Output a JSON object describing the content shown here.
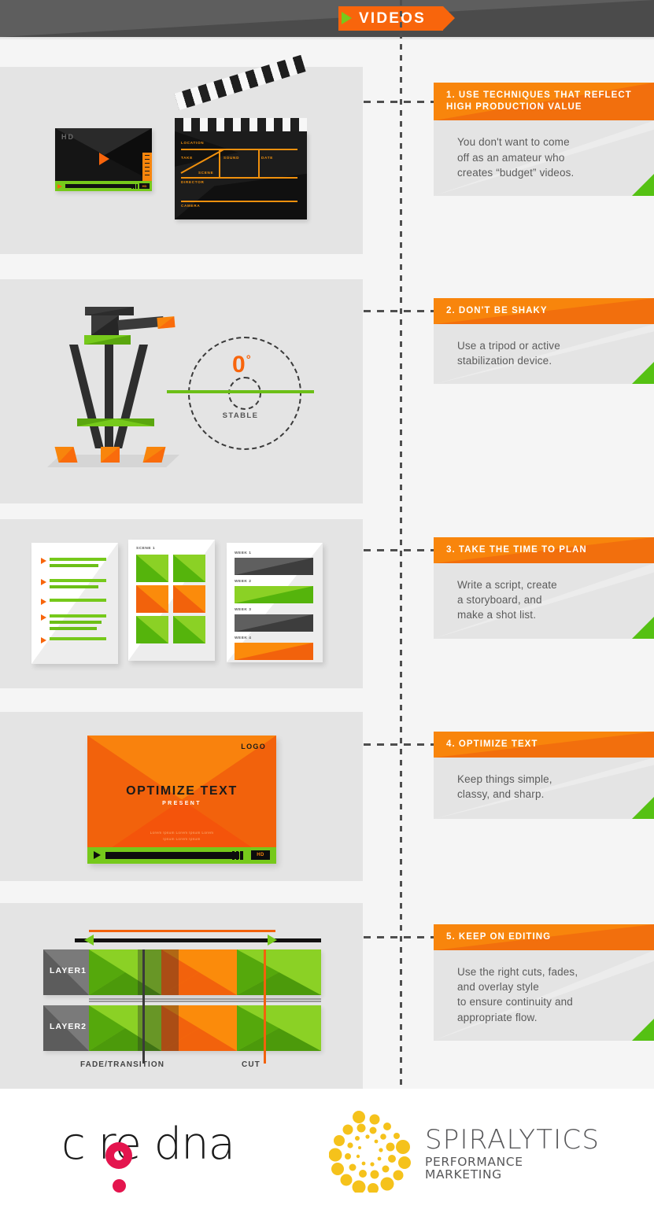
{
  "header": {
    "tag_label": "VIDEOS",
    "tag_arrow_icon": "play-triangle-icon",
    "colors": {
      "orange": "#f8650c",
      "green": "#76c91b",
      "dark_gray": "#5e5e5e"
    }
  },
  "tips": [
    {
      "title": "1. USE TECHNIQUES THAT REFLECT\nHIGH PRODUCTION VALUE",
      "body": "You don't want to come\noff as an amateur who\ncreates “budget” videos."
    },
    {
      "title": "2. DON'T BE SHAKY",
      "body": "Use a tripod or active\nstabilization device."
    },
    {
      "title": "3. TAKE THE TIME TO PLAN",
      "body": "Write a script, create\na storyboard, and\nmake a shot list."
    },
    {
      "title": "4. OPTIMIZE TEXT",
      "body": "Keep things simple,\nclassy, and sharp."
    },
    {
      "title": "5. KEEP ON EDITING",
      "body": "Use the right cuts, fades,\nand overlay style\nto ensure continuity and\nappropriate flow."
    }
  ],
  "illustration_1": {
    "player_hd_badge": "HD",
    "player_quality_badge": "HD",
    "play_icon": "play-triangle-icon",
    "clapper_fields": {
      "location": "LOCATION",
      "take": "TAKE",
      "sound": "SOUND",
      "date": "DATE",
      "scene": "SCENE",
      "director": "DIRECTOR",
      "camera": "CAMERA"
    }
  },
  "illustration_2": {
    "angle_value": "0",
    "angle_degree_symbol": "°",
    "caption": "STABLE"
  },
  "illustration_3": {
    "storyboard_label": "SCENE 1",
    "schedule_labels": [
      "WEEK 1",
      "WEEK 2",
      "WEEK 3",
      "WEEK 4"
    ],
    "schedule_bar_colors": [
      "#5f5f5f",
      "#8bd125",
      "#5f5f5f",
      "#fb8b0b"
    ],
    "storyboard_cell_colors": [
      "green",
      "green",
      "orange",
      "orange",
      "green",
      "green"
    ]
  },
  "illustration_4": {
    "logo_label": "LOGO",
    "title": "OPTIMIZE TEXT",
    "subtitle": "PRESENT",
    "body": "Lorem Ipsum Lorem Ipsum Lorem\nIpsum Lorem Ipsum",
    "quality_badge": "HD",
    "play_icon": "play-triangle-icon"
  },
  "illustration_5": {
    "layer_labels": [
      "LAYER1",
      "LAYER2"
    ],
    "marker_fade": "FADE/TRANSITION",
    "marker_cut": "CUT"
  },
  "footer": {
    "coredna_name": "c re dna",
    "spiralytics_name": "SPIRALYTICS",
    "spiralytics_tagline": "PERFORMANCE MARKETING",
    "spiralytics_color": "#f5c21b",
    "coredna_accent": "#e4154e"
  }
}
